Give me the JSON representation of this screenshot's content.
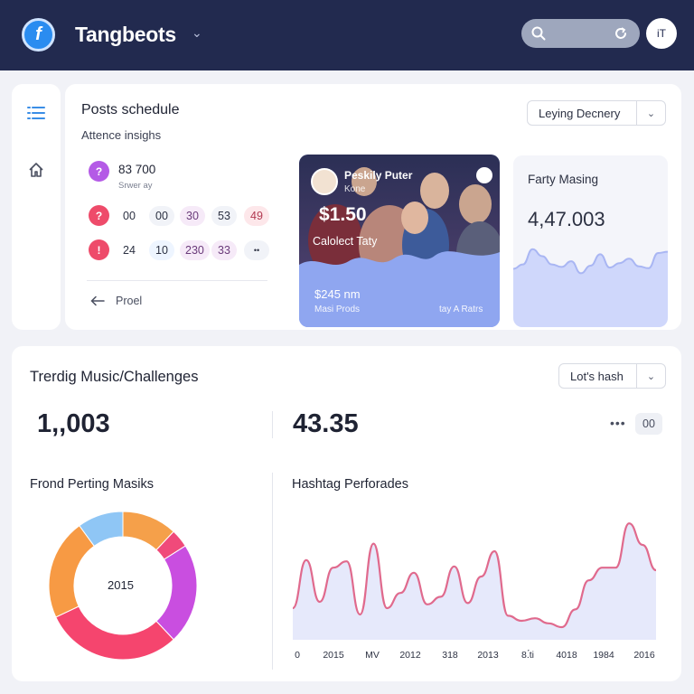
{
  "header": {
    "app_title": "Tangbeots",
    "logo_glyph": "f",
    "avatar_text": "iT"
  },
  "posts": {
    "title": "Posts schedule",
    "subtitle": "Attence insighs",
    "dropdown_label": "Leying Decnery",
    "stat1": {
      "value": "83 700",
      "caption": "Srwer ay"
    },
    "row2": [
      "00",
      "00",
      "30",
      "53",
      "49"
    ],
    "row3": [
      "24",
      "10",
      "230",
      "33",
      "••"
    ],
    "back_label": "Proel"
  },
  "media": {
    "name": "Peskily Puter",
    "handle": "Kone",
    "price": "$1.50",
    "caption": "Calolect Taty",
    "metric": "$245 nm",
    "metric_label": "Masi Prods",
    "right_label": "tay A Ratrs"
  },
  "farty": {
    "title": "Farty Masing",
    "value": "4,47.003",
    "series": [
      0.35,
      0.42,
      0.66,
      0.55,
      0.42,
      0.38,
      0.47,
      0.28,
      0.4,
      0.58,
      0.37,
      0.44,
      0.51,
      0.39,
      0.36,
      0.6,
      0.62
    ]
  },
  "trending": {
    "title": "Trerdig Music/Challenges",
    "dropdown_label": "Lot's hash",
    "kpi1": "1,,003",
    "kpi2": "43.35",
    "more": "•••",
    "badge": "00",
    "donut_title": "Frond Perting Masiks",
    "donut_center": "2015",
    "hashtag_title": "Hashtag Perforades"
  },
  "chart_data": [
    {
      "type": "pie",
      "title": "Frond Perting Masiks",
      "slices": [
        {
          "value": 12,
          "color": "#f5a04a"
        },
        {
          "value": 4,
          "color": "#f04a7a"
        },
        {
          "value": 22,
          "color": "#c94ee0"
        },
        {
          "value": 30,
          "color": "#f5456e"
        },
        {
          "value": 22,
          "color": "#f79a44"
        },
        {
          "value": 10,
          "color": "#8fc6f5"
        }
      ]
    },
    {
      "type": "area",
      "title": "Hashtag Perforades",
      "x_ticks": [
        "0",
        "2015",
        "MV",
        "2012",
        "318",
        "2013",
        "8.́ti",
        "4018",
        "1984",
        "2016"
      ],
      "values": [
        0.25,
        0.63,
        0.3,
        0.57,
        0.62,
        0.2,
        0.76,
        0.25,
        0.37,
        0.53,
        0.28,
        0.34,
        0.58,
        0.29,
        0.5,
        0.7,
        0.19,
        0.15,
        0.17,
        0.13,
        0.1,
        0.24,
        0.47,
        0.57,
        0.57,
        0.92,
        0.75,
        0.55
      ],
      "line_color": "#e06a8d",
      "fill_color": "#e6e9fb"
    }
  ]
}
